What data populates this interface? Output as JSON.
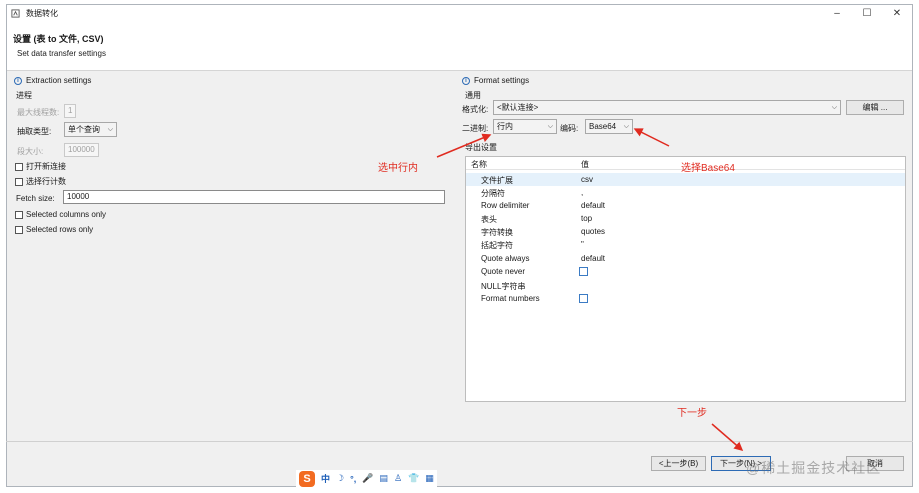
{
  "window": {
    "title": "数据转化",
    "minimize": "–",
    "maximize": "☐",
    "close": "✕"
  },
  "header": {
    "title": "设置 (表 to 文件, CSV)",
    "subtitle": "Set data transfer settings"
  },
  "extraction": {
    "title": "Extraction settings",
    "group": "进程",
    "max_threads_label": "最大线程数:",
    "max_threads_value": "1",
    "fetch_type_label": "抽取类型:",
    "fetch_type_value": "单个查询",
    "segment_size_label": "段大小:",
    "segment_size_value": "100000",
    "open_new_conn": "打开新连接",
    "select_row_count": "选择行计数",
    "fetch_size_label": "Fetch size:",
    "fetch_size_value": "10000",
    "selected_columns": "Selected columns only",
    "selected_rows": "Selected rows only"
  },
  "format": {
    "title": "Format settings",
    "group": "通用",
    "formatting_label": "格式化:",
    "formatting_value": "<默认连接>",
    "edit_button": "编辑 ...",
    "binary_label": "二进制:",
    "binary_value": "行内",
    "encoding_label": "编码:",
    "encoding_value": "Base64",
    "export_settings": "导出设置",
    "columns": {
      "name": "名称",
      "value": "值"
    },
    "rows": [
      {
        "name": "文件扩展",
        "value": "csv"
      },
      {
        "name": "分隔符",
        "value": ","
      },
      {
        "name": "Row delimiter",
        "value": "default"
      },
      {
        "name": "表头",
        "value": "top"
      },
      {
        "name": "字符转换",
        "value": "quotes"
      },
      {
        "name": "括起字符",
        "value": "\""
      },
      {
        "name": "Quote always",
        "value": "default"
      },
      {
        "name": "Quote never",
        "value": ""
      },
      {
        "name": "NULL字符串",
        "value": ""
      },
      {
        "name": "Format numbers",
        "value": ""
      }
    ]
  },
  "annotations": {
    "select_inline": "选中行内",
    "select_base64": "选择Base64",
    "next_step": "下一步"
  },
  "footer": {
    "back_button": "<上一步(B)",
    "next_button": "下一步(N) >",
    "cancel_button": "取消"
  },
  "ime": {
    "logo": "S",
    "items": [
      "中",
      "☽",
      "°,",
      "🎤",
      "▤",
      "♙",
      "👕",
      "▦"
    ]
  },
  "watermark": "@稀土掘金技术社区",
  "colors": {
    "annotation": "#e02b20",
    "selection": "#e5f1fb",
    "accent": "#2d6bb5"
  }
}
